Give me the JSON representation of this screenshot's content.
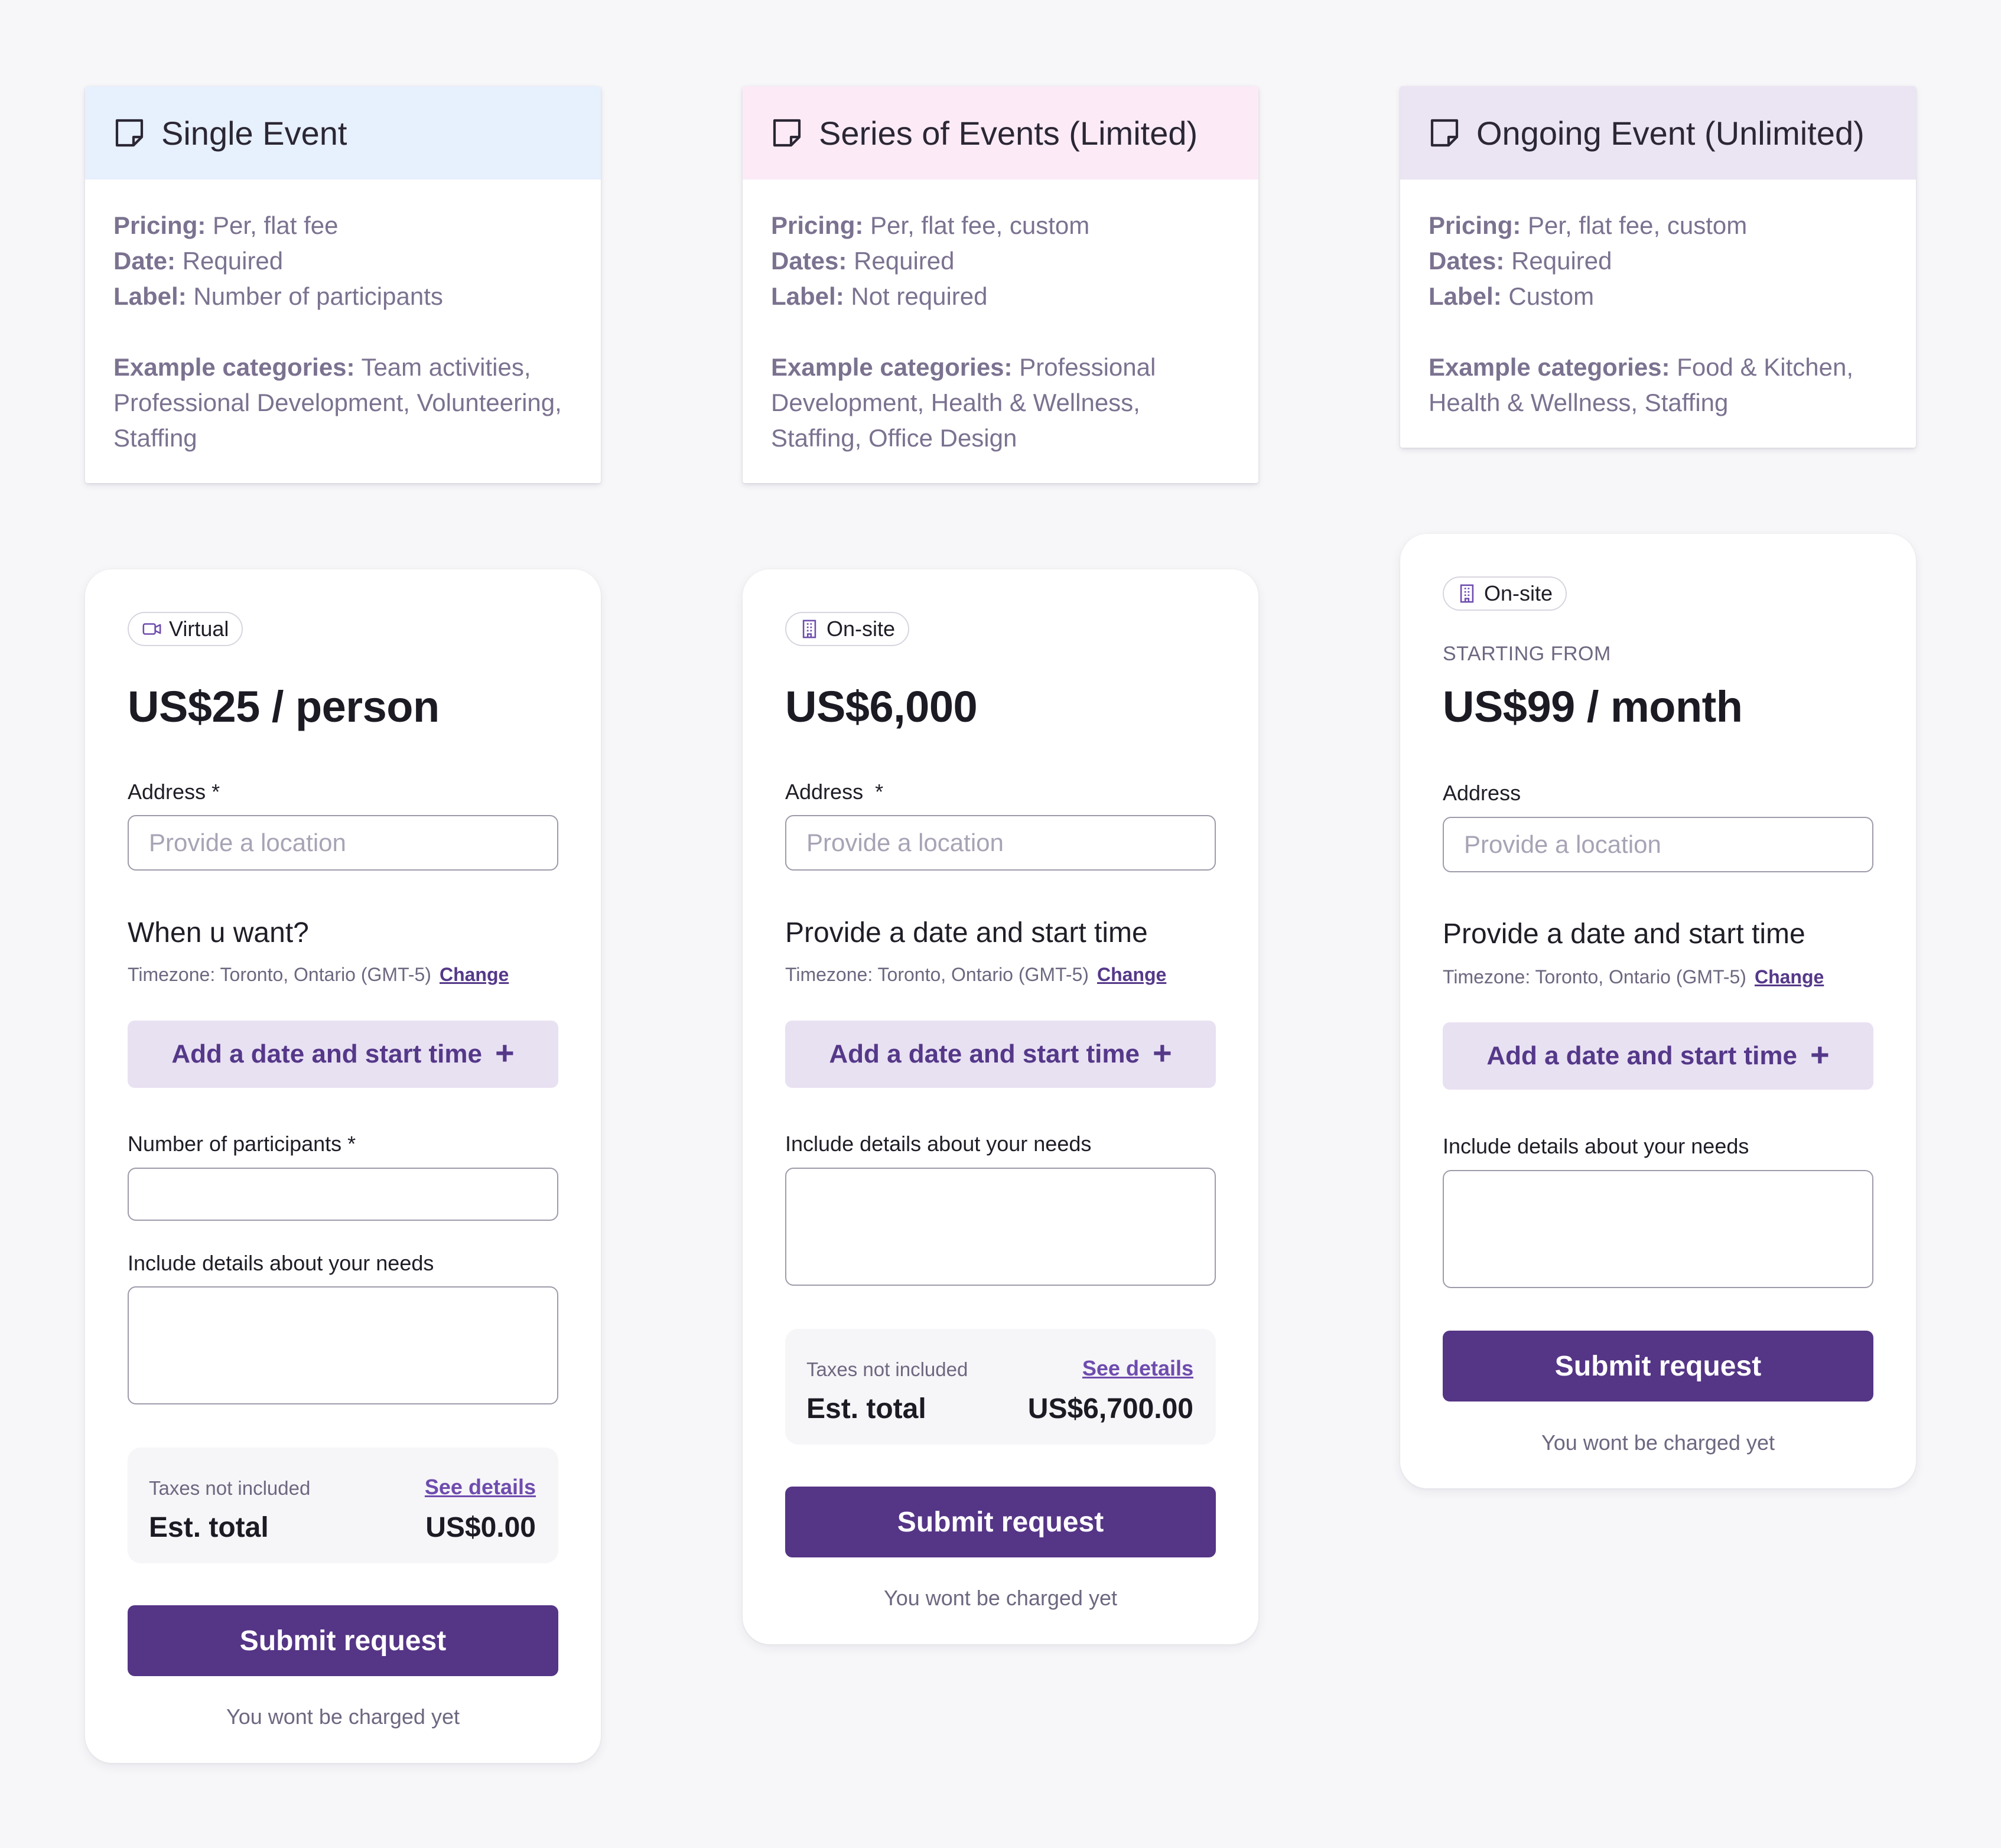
{
  "colors": {
    "background": "#f7f7f9",
    "single_header": "#e7f0fd",
    "series_header": "#fcebf7",
    "ongoing_header": "#ebe4f2",
    "accent": "#553586",
    "accent_light": "#e8e1f2"
  },
  "info_cards": [
    {
      "icon": "note-icon",
      "title": "Single Event",
      "pricing_label": "Pricing:",
      "pricing_value": "Per, flat fee",
      "date_label": "Date:",
      "date_value": "Required",
      "label_label": "Label:",
      "label_value": "Number of participants",
      "examples_label": "Example categories:",
      "examples_value": "Team activities, Professional Development, Volunteering, Staffing"
    },
    {
      "icon": "note-icon",
      "title": "Series of Events (Limited)",
      "pricing_label": "Pricing:",
      "pricing_value": "Per, flat fee, custom",
      "date_label": "Dates:",
      "date_value": "Required",
      "label_label": "Label:",
      "label_value": "Not required",
      "examples_label": "Example categories:",
      "examples_value": "Professional Development, Health & Wellness, Staffing, Office Design"
    },
    {
      "icon": "note-icon",
      "title": "Ongoing Event (Unlimited)",
      "pricing_label": "Pricing:",
      "pricing_value": "Per, flat fee, custom",
      "date_label": "Dates:",
      "date_value": "Required",
      "label_label": "Label:",
      "label_value": "Custom",
      "examples_label": "Example categories:",
      "examples_value": "Food & Kitchen, Health & Wellness, Staffing"
    }
  ],
  "booking_cards": [
    {
      "chip_icon": "video-camera-icon",
      "chip": "Virtual",
      "price": "US$25 / person",
      "address_label": "Address *",
      "address_placeholder": "Provide a location",
      "date_title": "When u want?",
      "timezone": "Timezone: Toronto, Ontario (GMT-5)",
      "change": "Change",
      "add_date": "Add a date and start time",
      "participants_label": "Number of participants *",
      "details_label": "Include details about your needs",
      "taxes": "Taxes not included",
      "see_details": "See details",
      "est_total_label": "Est. total",
      "est_total": "US$0.00",
      "submit": "Submit request",
      "charged": "You wont be charged yet"
    },
    {
      "chip_icon": "building-icon",
      "chip": "On-site",
      "price": "US$6,000",
      "address_label": "Address  *",
      "address_placeholder": "Provide a location",
      "date_title": "Provide a date and start time",
      "timezone": "Timezone: Toronto, Ontario (GMT-5)",
      "change": "Change",
      "add_date": "Add a date and start time",
      "details_label": "Include details about your needs",
      "taxes": "Taxes not included",
      "see_details": "See details",
      "est_total_label": "Est. total",
      "est_total": "US$6,700.00",
      "submit": "Submit request",
      "charged": "You wont be charged yet"
    },
    {
      "chip_icon": "building-icon",
      "chip": "On-site",
      "starting_from": "STARTING FROM",
      "price": "US$99 / month",
      "address_label": "Address",
      "address_placeholder": "Provide a location",
      "date_title": "Provide a date and start time",
      "timezone": "Timezone: Toronto, Ontario (GMT-5)",
      "change": "Change",
      "add_date": "Add a date and start time",
      "details_label": "Include details about your needs",
      "submit": "Submit request",
      "charged": "You wont be charged yet"
    }
  ]
}
